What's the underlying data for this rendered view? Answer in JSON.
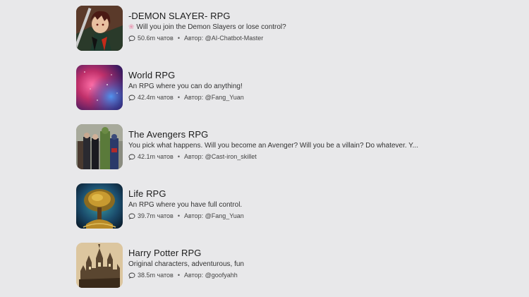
{
  "items": [
    {
      "title": "-DEMON SLAYER- RPG",
      "desc_prefix_icon": "flower-icon",
      "desc": "Will you join the Demon Slayers or lose control?",
      "chats": "50.6m чатов",
      "author_label": "Автор:",
      "author": "@AI-Chatbot-Master",
      "thumb": "demon-slayer-thumbnail"
    },
    {
      "title": "World RPG",
      "desc": "An RPG where you can do anything!",
      "chats": "42.4m чатов",
      "author_label": "Автор:",
      "author": "@Fang_Yuan",
      "thumb": "nebula-thumbnail"
    },
    {
      "title": "The Avengers RPG",
      "desc": "You pick what happens. Will you become an Avenger? Will you be a villain? Do whatever. Y...",
      "chats": "42.1m чатов",
      "author_label": "Автор:",
      "author": "@Cast-iron_skillet",
      "thumb": "avengers-thumbnail"
    },
    {
      "title": "Life RPG",
      "desc": "An RPG where you have full control.",
      "chats": "39.7m чатов",
      "author_label": "Автор:",
      "author": "@Fang_Yuan",
      "thumb": "tree-of-life-thumbnail"
    },
    {
      "title": "Harry Potter RPG",
      "desc": "Original characters, adventurous, fun",
      "chats": "38.5m чатов",
      "author_label": "Автор:",
      "author": "@goofyahh",
      "thumb": "hogwarts-thumbnail"
    }
  ],
  "separator": "•",
  "icons": {
    "chat": "chat-bubble-icon"
  }
}
